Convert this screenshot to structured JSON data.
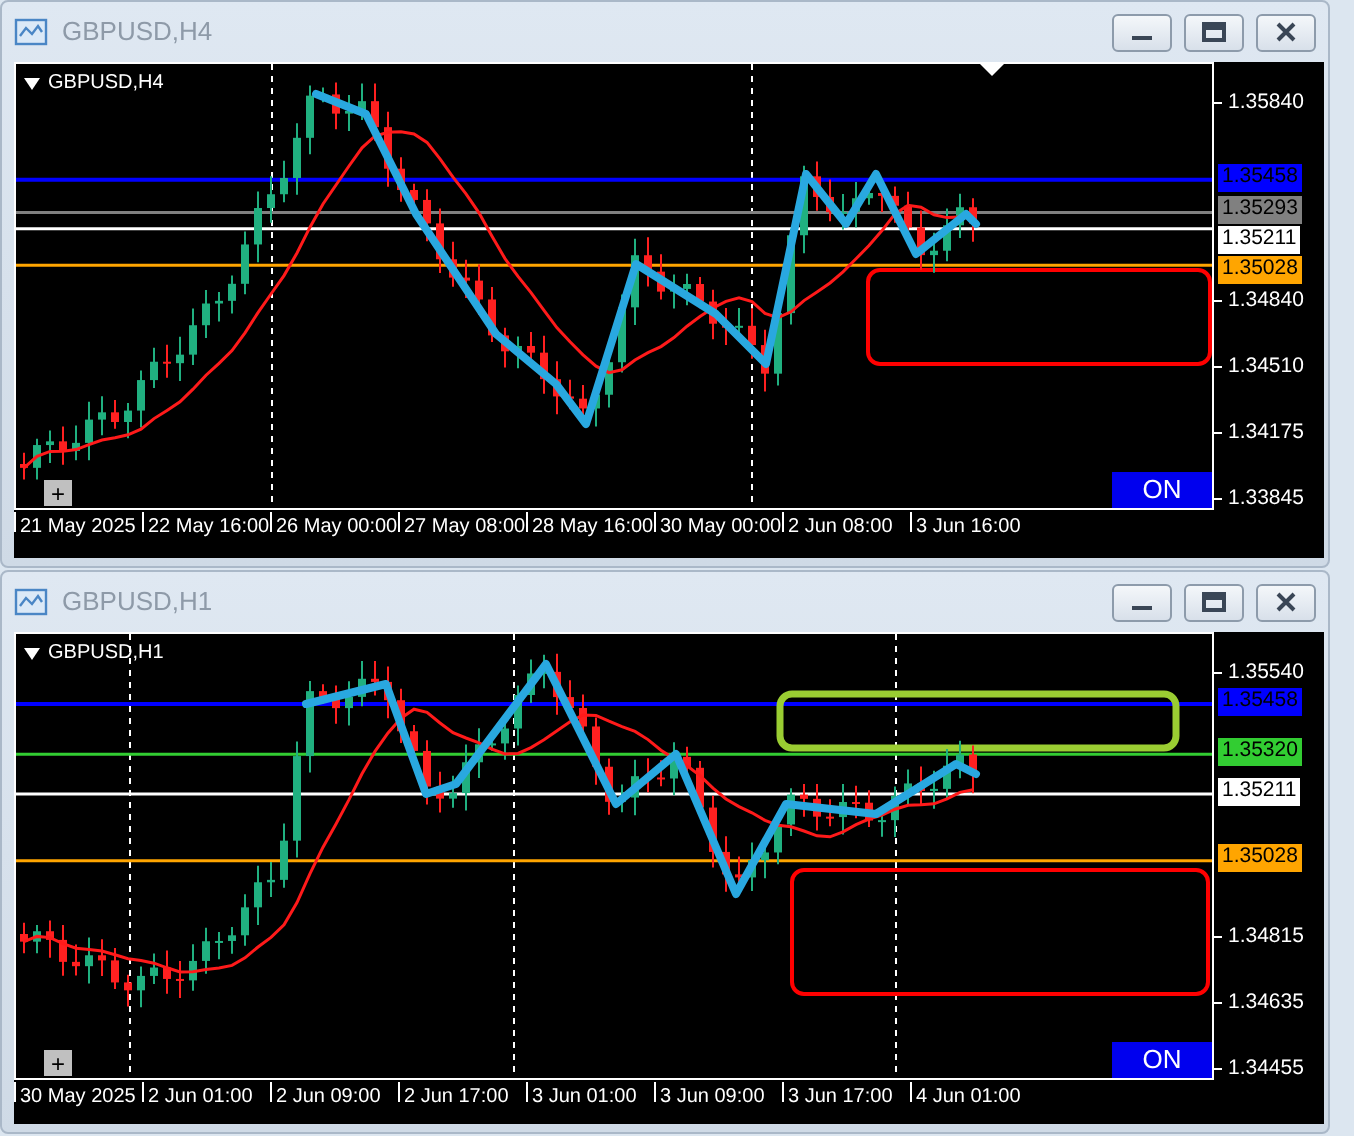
{
  "charts": [
    {
      "window_title": "GBPUSD,H4",
      "symbol_label": "GBPUSD,H4",
      "shift_marker": true,
      "zoom_button": "+",
      "toggle_button": "ON",
      "price_ticks": [
        "1.35840",
        "1.34840",
        "1.34510",
        "1.34175",
        "1.33845"
      ],
      "price_lines": [
        {
          "price": "1.35458",
          "color": "#0000ff"
        },
        {
          "price": "1.35293",
          "color": "#808080"
        },
        {
          "price": "1.35211",
          "color": "#ffffff"
        },
        {
          "price": "1.35028",
          "color": "#ffa500"
        }
      ],
      "zones": [
        {
          "color": "#ff0000"
        }
      ],
      "time_labels": [
        "21 May 2025",
        "22 May 16:00",
        "26 May 00:00",
        "27 May 08:00",
        "28 May 16:00",
        "30 May 00:00",
        "2 Jun 08:00",
        "3 Jun 16:00"
      ]
    },
    {
      "window_title": "GBPUSD,H1",
      "symbol_label": "GBPUSD,H1",
      "shift_marker": false,
      "zoom_button": "+",
      "toggle_button": "ON",
      "price_ticks": [
        "1.35540",
        "1.34815",
        "1.34635",
        "1.34455"
      ],
      "price_lines": [
        {
          "price": "1.35458",
          "color": "#0000ff"
        },
        {
          "price": "1.35320",
          "color": "#32cd32"
        },
        {
          "price": "1.35211",
          "color": "#ffffff"
        },
        {
          "price": "1.35028",
          "color": "#ffa500"
        }
      ],
      "zones": [
        {
          "color": "#9acd32"
        },
        {
          "color": "#ff0000"
        }
      ],
      "time_labels": [
        "30 May 2025",
        "2 Jun 01:00",
        "2 Jun 09:00",
        "2 Jun 17:00",
        "3 Jun 01:00",
        "3 Jun 09:00",
        "3 Jun 17:00",
        "4 Jun 01:00"
      ]
    }
  ]
}
